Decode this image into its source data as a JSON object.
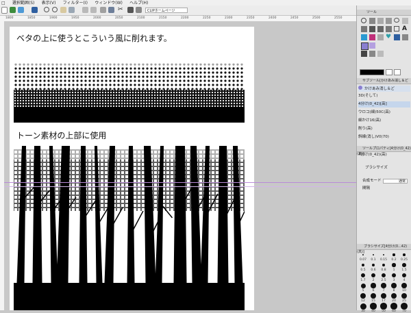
{
  "menu": [
    "□",
    "選択範囲(S)",
    "表示(V)",
    "フィルター(I)",
    "ウィンドウ(W)",
    "ヘルプ(H)"
  ],
  "toolbar": {
    "combo": "CLIPホームページ"
  },
  "ruler": [
    "1800",
    "1850",
    "1900",
    "1950",
    "2000",
    "2050",
    "2100",
    "2150",
    "2200",
    "2250",
    "2300",
    "2350",
    "2400",
    "2450",
    "2500",
    "2550"
  ],
  "canvas": {
    "heading1": "ベタの上に使うとこういう風に削れます。",
    "heading2": "トーン素材の上部に使用"
  },
  "panel": {
    "top_tab": "ツール",
    "subtool_tab": "サブツール[かけあみ消し＆ど",
    "subtool_active": "かけあみ消し＆ど",
    "list": [
      "3D(そして)",
      "4分け(0_42)[高]",
      "ウロコ(細)50C(高)",
      "細かけ16(高)",
      "削り(高)",
      "斜線(消し)V0(70)"
    ],
    "prop_tab": "ツールプロパティ[4分け(0_42)(高)]",
    "prop_title": "4分け(0_42)(高)",
    "brush_size_label": "ブラシサイズ",
    "blend_label": "合成モード",
    "blend_value": "通常",
    "gap_label": "間隔",
    "bs_tab": "ブラシサイズ[4分け(0...42)(高)]",
    "bs_labels": [
      "0.07",
      "0.1",
      "0.15",
      "0.2",
      "0.25",
      "0.5",
      "0.6",
      "0.8",
      "1",
      "1.5",
      "1.7",
      "2",
      "2.5",
      "3",
      "4",
      "5",
      "6",
      "7",
      "8",
      "10",
      "12",
      "15",
      "17",
      "20",
      "25",
      "30",
      "40",
      "50",
      "60",
      "70"
    ]
  }
}
